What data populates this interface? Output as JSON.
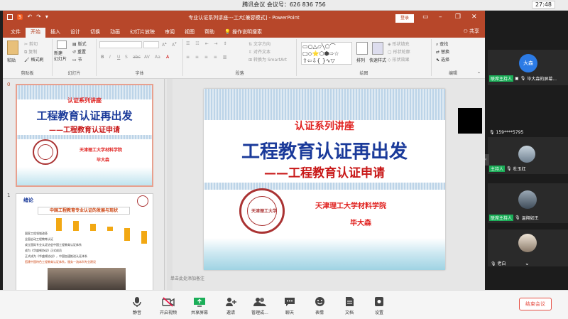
{
  "meeting": {
    "title": "腾讯会议 会议号：626 836 756",
    "time": "27:48",
    "end_label": "结束会议"
  },
  "ppt": {
    "title": "专业认证系列讲座---工大[兼容模式] - PowerPoint",
    "login": "登录",
    "share": "共享",
    "tabs": [
      "文件",
      "开始",
      "插入",
      "设计",
      "切换",
      "动画",
      "幻灯片放映",
      "审阅",
      "视图",
      "帮助"
    ],
    "tell_me": "操作说明搜索",
    "ribbon": {
      "clipboard": {
        "paste": "粘贴",
        "cut": "剪切",
        "copy": "复制",
        "format_painter": "格式刷",
        "label": "剪贴板"
      },
      "slides": {
        "new_slide": "新建\n幻灯片",
        "layout": "版式",
        "reset": "重置",
        "section": "节",
        "label": "幻灯片"
      },
      "font": {
        "label": "字体",
        "bold": "B",
        "italic": "I",
        "underline": "U",
        "strike": "S",
        "abc": "abc",
        "av": "AV",
        "aa": "Aa"
      },
      "paragraph": {
        "label": "段落",
        "text_direction": "文字方向",
        "align_text": "对齐文本",
        "smartart": "转换为 SmartArt"
      },
      "drawing": {
        "label": "绘图",
        "arrange": "排列",
        "quick_styles": "快速样式",
        "fill": "形状填充",
        "outline": "形状轮廓",
        "effects": "形状效果"
      },
      "editing": {
        "label": "编辑",
        "find": "查找",
        "replace": "替换",
        "select": "选择"
      }
    },
    "slide_numbers": [
      "0",
      "1"
    ],
    "notes_placeholder": "单击此处添加备注"
  },
  "slide0": {
    "series": "认证系列讲座",
    "main_title": "工程教育认证再出发",
    "subtitle": "——工程教育认证申请",
    "university": "天津理工大学材料学院",
    "author": "毕大森"
  },
  "slide1": {
    "section": "绪论",
    "heading": "中国工程教育专业认证的发展与现状",
    "years": [
      "2006",
      "2008",
      "2013",
      "2015",
      "2016",
      "2018"
    ],
    "items": [
      "国家工程领域改革",
      "全面启动工程教育认证",
      "成立国际专业认证协会中国工程教育认证体系",
      "成为《华盛顿协议》正式成员",
      "正式成为《华盛顿协议》，中国加速推进认证体系",
      "搭建中国特色工程教育认证体系，服务一流本科专业建设"
    ]
  },
  "participants": [
    {
      "avatar_text": "大森",
      "host": "联席主持人",
      "name": "毕大森的屏幕..."
    },
    {
      "name": "159****5795"
    },
    {
      "host": "主持人",
      "name": "杜玉红"
    },
    {
      "host": "联席主持人",
      "name": "温翔如王"
    },
    {
      "name": "老白"
    }
  ],
  "toolbar": [
    {
      "icon": "microphone-icon",
      "label": "静音"
    },
    {
      "icon": "video-off-icon",
      "label": "开启视频"
    },
    {
      "icon": "share-screen-icon",
      "label": "共享屏幕"
    },
    {
      "icon": "invite-icon",
      "label": "邀请"
    },
    {
      "icon": "members-icon",
      "label": "管理成..."
    },
    {
      "icon": "chat-icon",
      "label": "聊天"
    },
    {
      "icon": "reaction-icon",
      "label": "表情"
    },
    {
      "icon": "document-icon",
      "label": "文档"
    },
    {
      "icon": "settings-icon",
      "label": "设置"
    }
  ],
  "colors": {
    "ppt_red": "#b7472a",
    "host_green": "#1bae58",
    "end_red": "#e65045",
    "title_blue": "#1a3a9a"
  }
}
